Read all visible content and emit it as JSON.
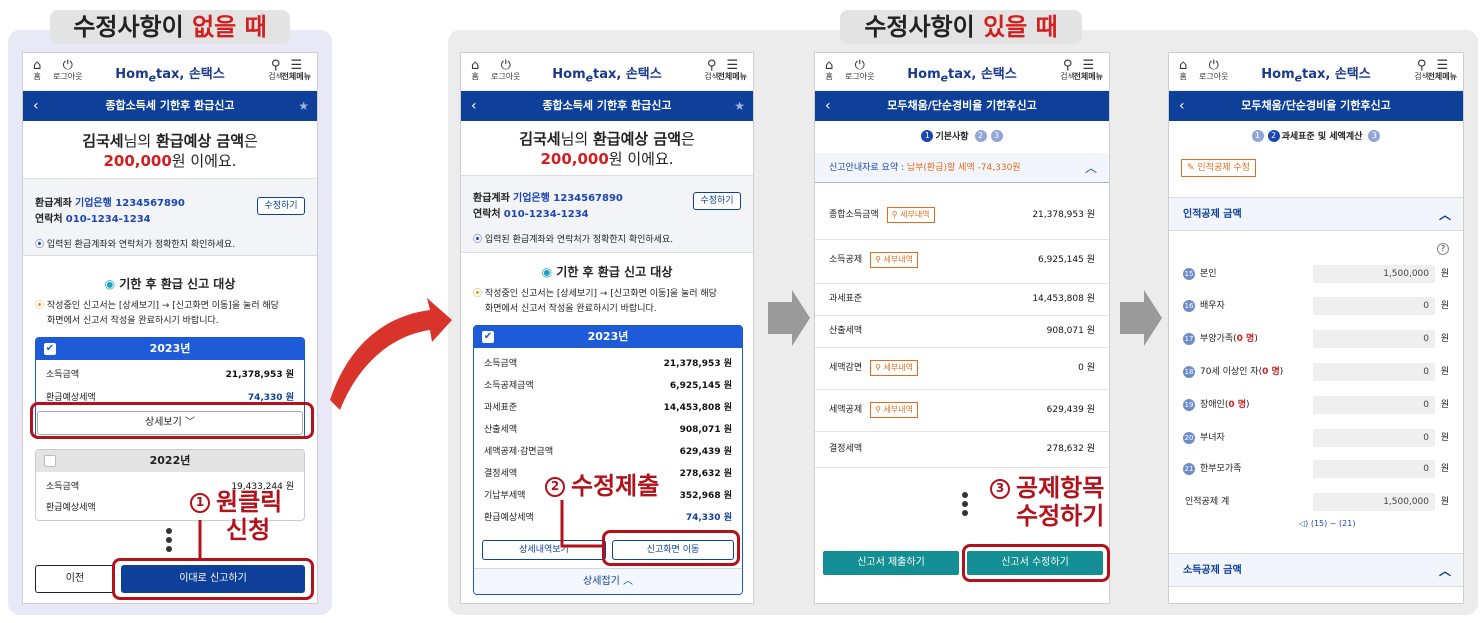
{
  "headings": {
    "left": {
      "pre": "수정사항이 ",
      "hl": "없을 때"
    },
    "right": {
      "pre": "수정사항이 ",
      "hl": "있을 때"
    }
  },
  "common": {
    "home": "홈",
    "logout": "로그아웃",
    "logo_brand": "Hom",
    "logo_e": "e",
    "logo_brand2": "tax",
    "logo_kr": ", 손택스",
    "search": "검색",
    "menu": "전체메뉴",
    "back": "‹",
    "star": "★"
  },
  "screen1": {
    "nav_title": "종합소득세 기한후 환급신고",
    "greeting_name": "김국세",
    "greeting_mid": "님의 ",
    "greeting_bold": "환급예상 금액",
    "greeting_end": "은",
    "amount": "200,000",
    "amount_suffix": "원 이에요.",
    "account_label": "환급계좌",
    "account_value": "기업은행 1234567890",
    "phone_label": "연락처",
    "phone_value": "010-1234-1234",
    "edit_button": "수정하기",
    "notice1": "입력된 환급계좌와 연락처가 정확한지 확인하세요.",
    "section_title": "기한 후 환급 신고 대상",
    "notice2_line1": "작성중인 신고서는 [상세보기] → [신고화면 이동]을 눌러 해당",
    "notice2_line2": "화면에서 신고서 작성을 완료하시기 바랍니다.",
    "year1": "2023년",
    "year1_rows": [
      {
        "label": "소득금액",
        "value": "21,378,953 원"
      },
      {
        "label": "환급예상세액",
        "value": "74,330 원"
      }
    ],
    "detail_button": "상세보기 ﹀",
    "year2": "2022년",
    "year2_rows": [
      {
        "label": "소득금액",
        "value": "19,433,244 원"
      },
      {
        "label": "환급예상세액",
        "value": ""
      }
    ],
    "prev_button": "이전",
    "submit_button": "이대로 신고하기"
  },
  "screen2": {
    "nav_title": "종합소득세 기한후 환급신고",
    "year1": "2023년",
    "rows": [
      {
        "label": "소득금액",
        "value": "21,378,953 원"
      },
      {
        "label": "소득공제금액",
        "value": "6,925,145 원"
      },
      {
        "label": "과세표준",
        "value": "14,453,808 원"
      },
      {
        "label": "산출세액",
        "value": "908,071 원"
      },
      {
        "label": "세액공제·감면금액",
        "value": "629,439 원"
      },
      {
        "label": "결정세액",
        "value": "278,632 원"
      },
      {
        "label": "기납부세액",
        "value": "352,968 원"
      },
      {
        "label": "환급예상세액",
        "value": "74,330 원"
      }
    ],
    "detail_list_button": "상세내역보기",
    "move_button": "신고화면 이동",
    "collapse_button": "상세접기 ︿"
  },
  "screen3": {
    "nav_title": "모두채움/단순경비율 기한후신고",
    "step_label": "기본사항",
    "summary_label": "신고안내자료 요약 : ",
    "summary_value": "납부(환급)할 세액 -74,330원",
    "tax_detail": "세부내역",
    "rows": [
      {
        "label": "종합소득금액",
        "detail": true,
        "value": "21,378,953  원"
      },
      {
        "label": "소득공제",
        "detail": true,
        "value": "6,925,145  원"
      },
      {
        "label": "과세표준",
        "detail": false,
        "value": "14,453,808  원"
      },
      {
        "label": "산출세액",
        "detail": false,
        "value": "908,071  원"
      },
      {
        "label": "세액감면",
        "detail": true,
        "value": "0  원"
      },
      {
        "label": "세액공제",
        "detail": true,
        "value": "629,439  원"
      },
      {
        "label": "결정세액",
        "detail": false,
        "value": "278,632  원"
      }
    ],
    "submit_button": "신고서 제출하기",
    "edit_button": "신고서 수정하기"
  },
  "screen4": {
    "nav_title": "모두채움/단순경비율 기한후신고",
    "step_label": "과세표준 및 세액계산",
    "edit_deduction": "인적공제 수정",
    "section_title": "인적공제 금액",
    "help": "?",
    "rows": [
      {
        "n": "15",
        "label": "본인",
        "cnt": "",
        "value": "1,500,000",
        "unit": "원"
      },
      {
        "n": "16",
        "label": "배우자",
        "cnt": "",
        "value": "0",
        "unit": "원"
      },
      {
        "n": "17",
        "label": "부양가족(",
        "cnt": "0 명",
        "value": "0",
        "unit": "원"
      },
      {
        "n": "18",
        "label": "70세 이상인 자(",
        "cnt": "0 명",
        "value": "0",
        "unit": "원"
      },
      {
        "n": "19",
        "label": "장애인(",
        "cnt": "0 명",
        "value": "0",
        "unit": "원"
      },
      {
        "n": "20",
        "label": "부녀자",
        "cnt": "",
        "value": "0",
        "unit": "원"
      },
      {
        "n": "21",
        "label": "한부모가족",
        "cnt": "",
        "value": "0",
        "unit": "원"
      }
    ],
    "total_label": "인적공제 계",
    "total_value": "1,500,000",
    "total_unit": "원",
    "range_note": "(15) ~ (21)",
    "income_deduction": "소득공제 금액"
  },
  "annotations": {
    "a1_num": "1",
    "a1_line1": "원클릭",
    "a1_line2": "신청",
    "a2_num": "2",
    "a2_text": "수정제출",
    "a3_num": "3",
    "a3_line1": "공제항목",
    "a3_line2": "수정하기"
  }
}
